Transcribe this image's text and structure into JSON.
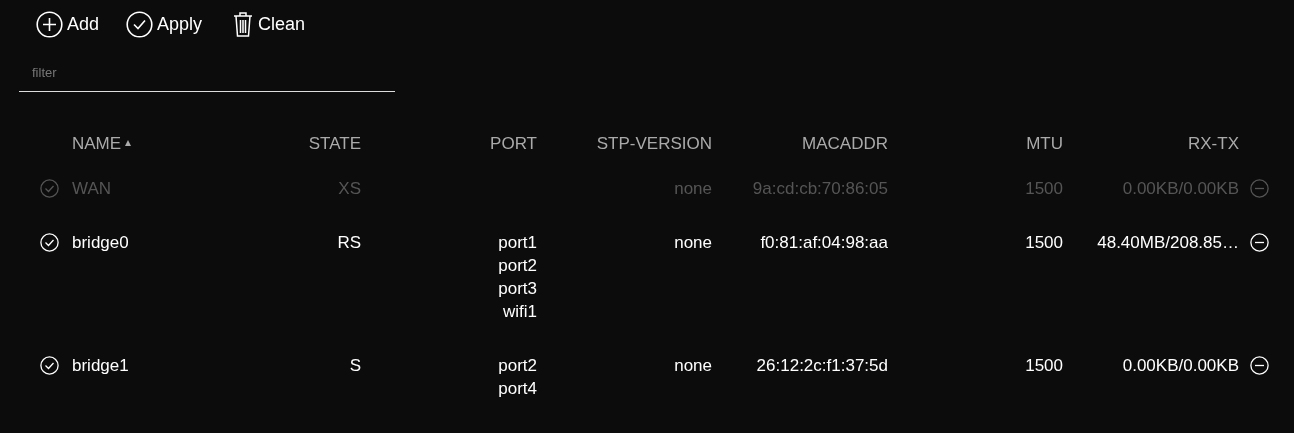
{
  "toolbar": [
    {
      "kind": "add",
      "label": "Add"
    },
    {
      "kind": "apply",
      "label": "Apply"
    },
    {
      "kind": "clean",
      "label": "Clean"
    }
  ],
  "filter": {
    "placeholder": "filter"
  },
  "table": {
    "columns": [
      {
        "label": "NAME",
        "sorted": true
      },
      {
        "label": "STATE",
        "sorted": false
      },
      {
        "label": "PORT",
        "sorted": false
      },
      {
        "label": "STP-VERSION",
        "sorted": false
      },
      {
        "label": "MACADDR",
        "sorted": false
      },
      {
        "label": "MTU",
        "sorted": false
      },
      {
        "label": "RX-TX",
        "sorted": false
      }
    ],
    "rows": [
      {
        "enabled": false,
        "name": "WAN",
        "state": "XS",
        "ports": [],
        "stp_version": "none",
        "macaddr": "9a:cd:cb:70:86:05",
        "mtu": "1500",
        "rx_tx": "0.00KB/0.00KB"
      },
      {
        "enabled": true,
        "name": "bridge0",
        "state": "RS",
        "ports": [
          "port1",
          "port2",
          "port3",
          "wifi1"
        ],
        "stp_version": "none",
        "macaddr": "f0:81:af:04:98:aa",
        "mtu": "1500",
        "rx_tx": "48.40MB/208.85…"
      },
      {
        "enabled": true,
        "name": "bridge1",
        "state": "S",
        "ports": [
          "port2",
          "port4"
        ],
        "stp_version": "none",
        "macaddr": "26:12:2c:f1:37:5d",
        "mtu": "1500",
        "rx_tx": "0.00KB/0.00KB"
      }
    ]
  }
}
